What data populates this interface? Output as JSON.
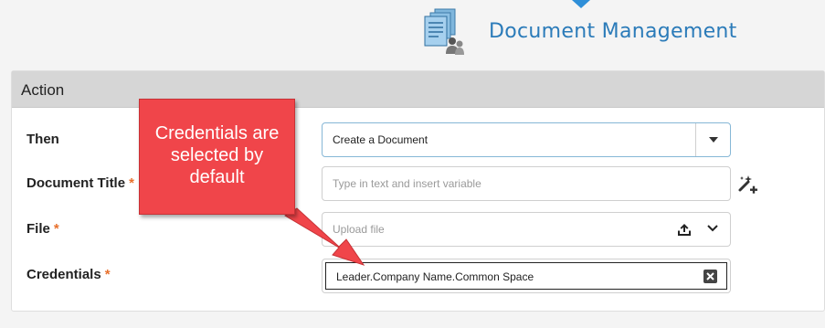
{
  "app": {
    "title": "Document Management",
    "icon": "document-management-icon"
  },
  "panel": {
    "header": "Action",
    "then": {
      "label": "Then",
      "value": "Create a Document"
    },
    "document_title": {
      "label": "Document Title",
      "required_mark": "*",
      "placeholder": "Type in text and insert variable"
    },
    "file": {
      "label": "File",
      "required_mark": "*",
      "placeholder": "Upload file"
    },
    "credentials": {
      "label": "Credentials",
      "required_mark": "*",
      "value": "Leader.Company Name.Common Space"
    }
  },
  "callout": {
    "lines": [
      "Credentials are",
      "selected by",
      "default"
    ]
  },
  "colors": {
    "accent": "#2b7bb9",
    "required": "#e8712d",
    "callout": "#f0454a"
  }
}
